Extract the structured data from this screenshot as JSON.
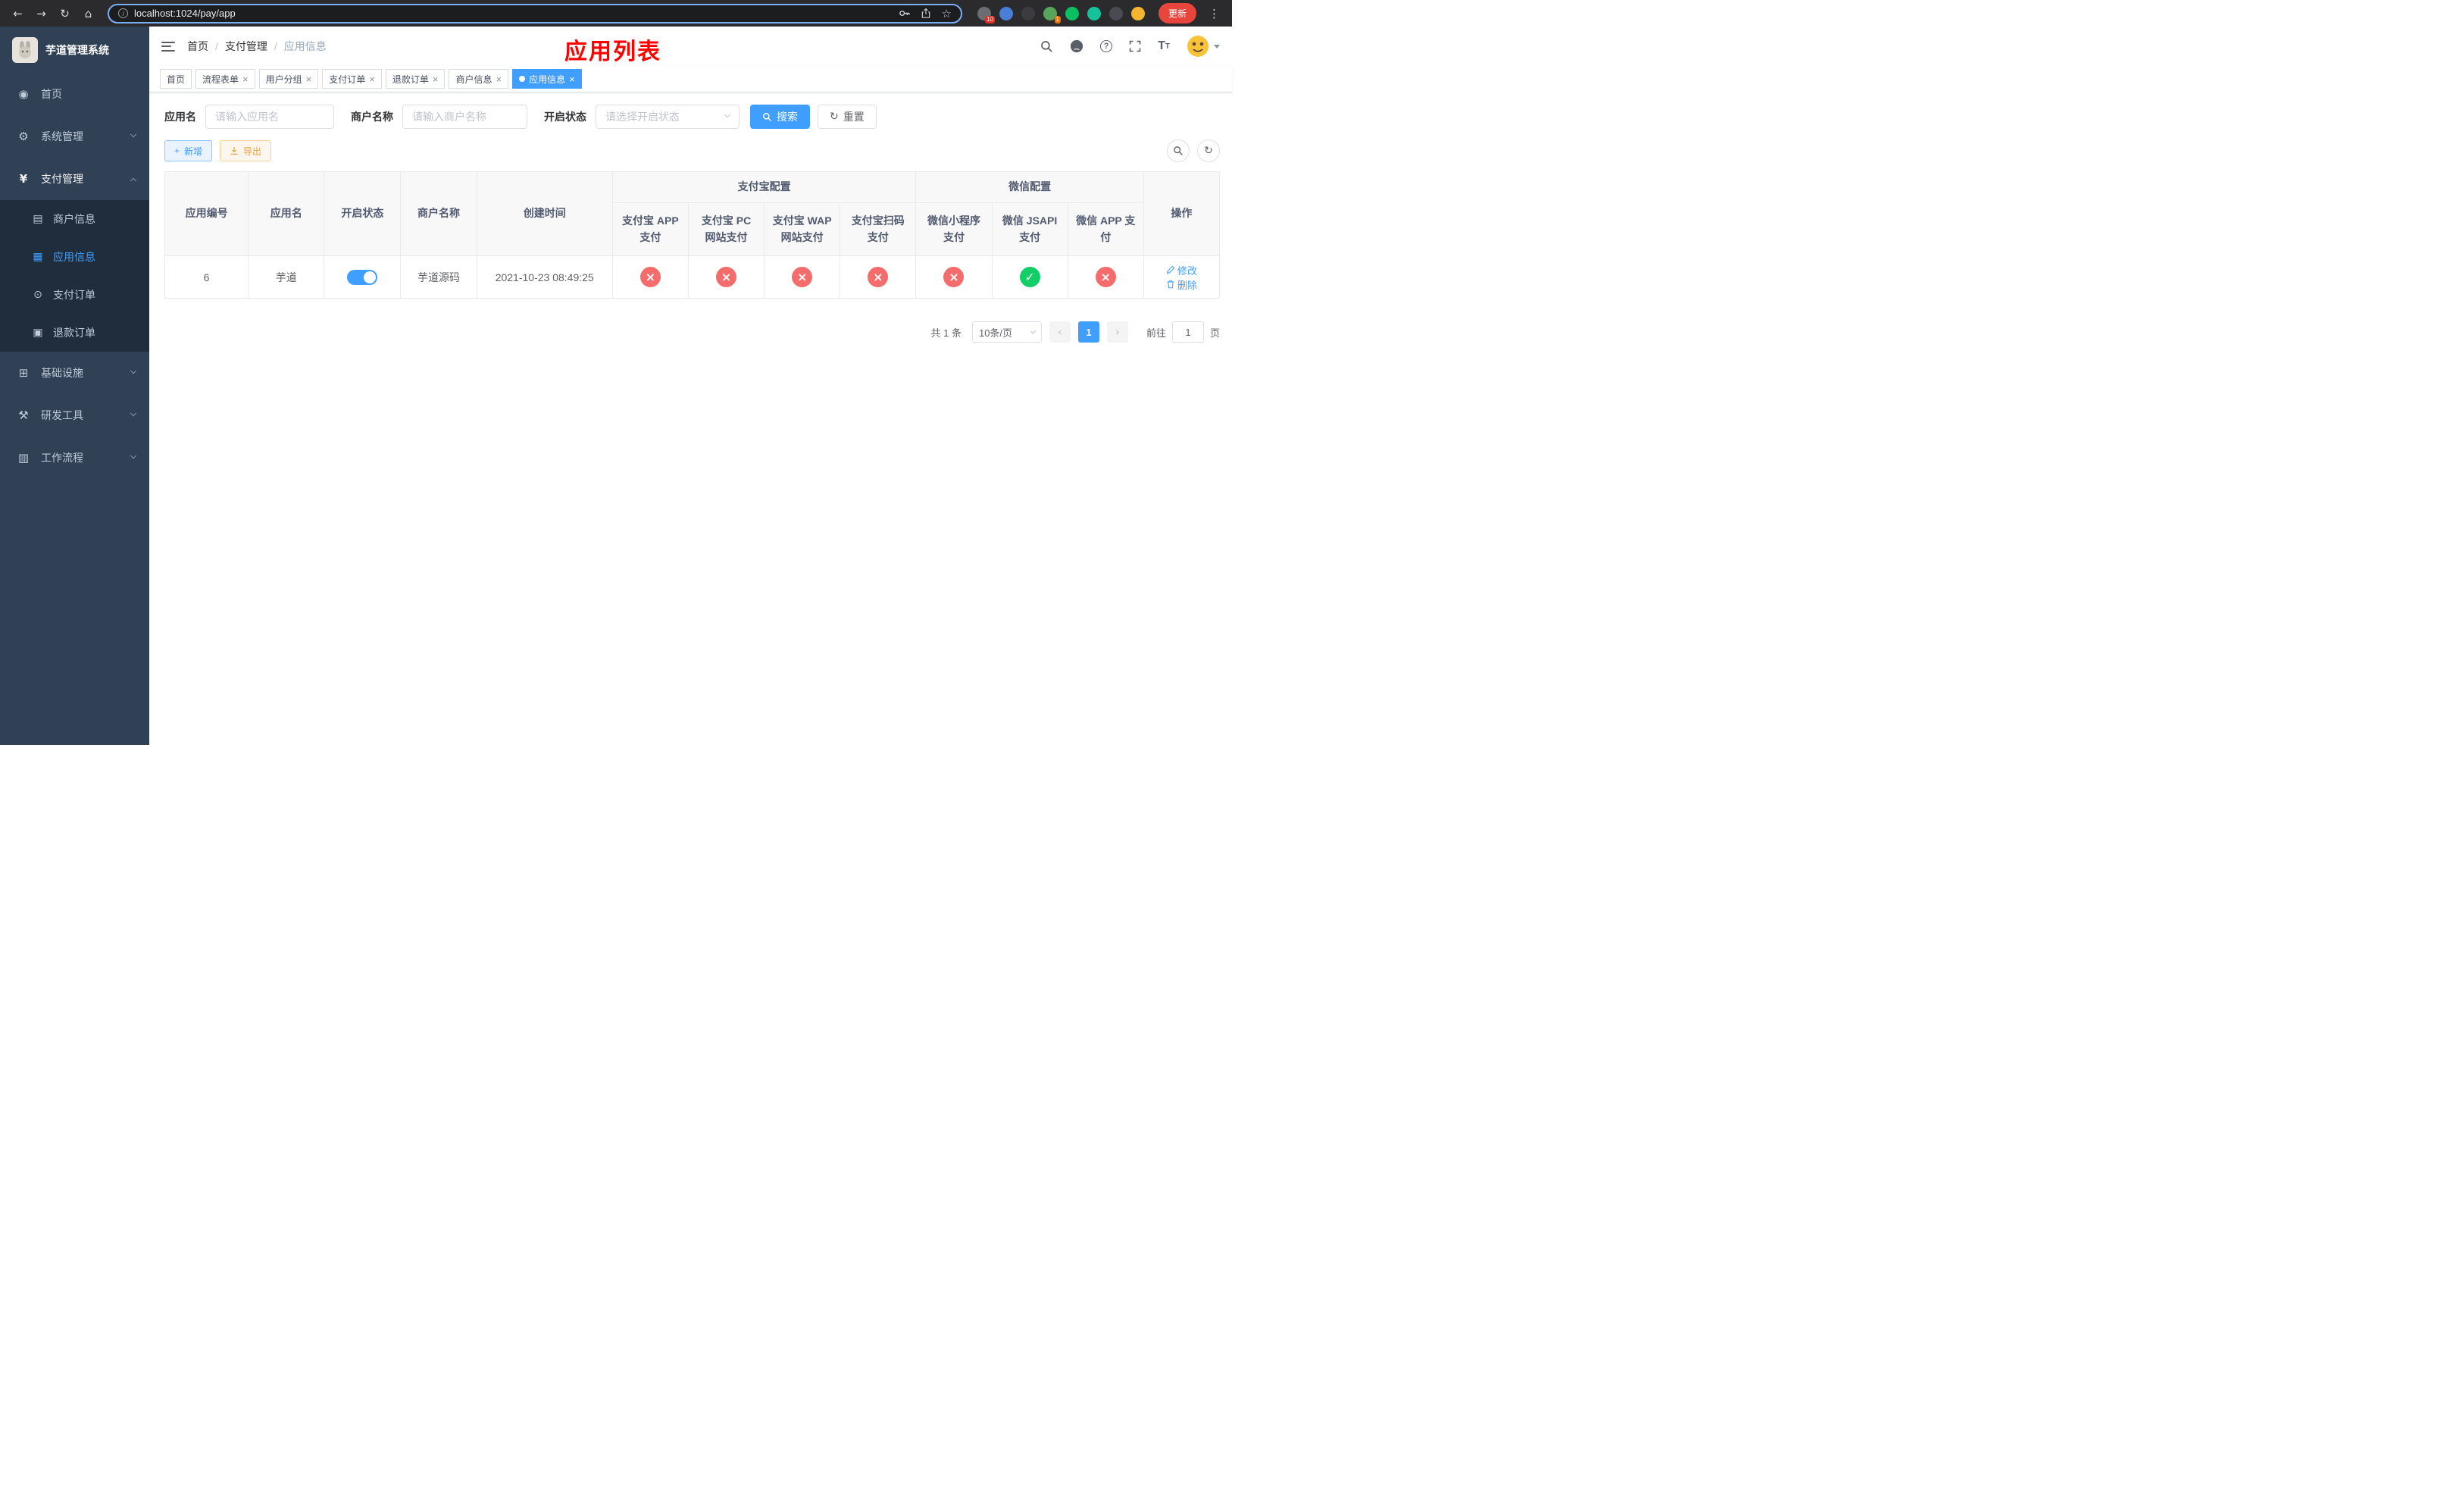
{
  "colors": {
    "accent": "#409eff",
    "danger": "#f56c6c",
    "success": "#13ce66",
    "warning": "#e6a23c",
    "annotation_red": "#ff0000",
    "sidebar_bg": "#304156",
    "submenu_bg": "#1f2d3d"
  },
  "browser": {
    "url": "localhost:1024/pay/app",
    "update_label": "更新",
    "extensions": [
      {
        "name": "extensions-puzzle",
        "color": "#6a6d72",
        "badge": "10",
        "badge_color": "#d93025"
      },
      {
        "name": "ext-blue-gem",
        "color": "#4a7dd6",
        "badge": ""
      },
      {
        "name": "ext-dark-circle",
        "color": "#3c3c40",
        "badge": ""
      },
      {
        "name": "ext-green-avatar",
        "color": "#57a55a",
        "badge": "1",
        "badge_color": "#e8710a"
      },
      {
        "name": "ext-teal-check",
        "color": "#07c160",
        "badge": ""
      },
      {
        "name": "ext-green-square",
        "color": "#15c39a",
        "badge": ""
      },
      {
        "name": "ext-pinwheel",
        "color": "#4a4a52",
        "badge": ""
      },
      {
        "name": "ext-emoji-face",
        "color": "#f5b52e",
        "badge": ""
      }
    ]
  },
  "sidebar": {
    "logo_title": "芋道管理系统",
    "items": [
      {
        "label": "首页"
      },
      {
        "label": "系统管理"
      },
      {
        "label": "支付管理"
      },
      {
        "label": "商户信息"
      },
      {
        "label": "应用信息"
      },
      {
        "label": "支付订单"
      },
      {
        "label": "退款订单"
      },
      {
        "label": "基础设施"
      },
      {
        "label": "研发工具"
      },
      {
        "label": "工作流程"
      }
    ]
  },
  "header": {
    "breadcrumb": [
      "首页",
      "支付管理",
      "应用信息"
    ],
    "annotation_title": "应用列表"
  },
  "tabs": [
    {
      "label": "首页"
    },
    {
      "label": "流程表单"
    },
    {
      "label": "用户分组"
    },
    {
      "label": "支付订单"
    },
    {
      "label": "退款订单"
    },
    {
      "label": "商户信息"
    },
    {
      "label": "应用信息"
    }
  ],
  "filters": {
    "app_name_label": "应用名",
    "app_name_placeholder": "请输入应用名",
    "merchant_label": "商户名称",
    "merchant_placeholder": "请输入商户名称",
    "status_label": "开启状态",
    "status_placeholder": "请选择开启状态",
    "search_button": "搜索",
    "reset_button": "重置"
  },
  "toolbar": {
    "add_button": "新增",
    "export_button": "导出"
  },
  "table": {
    "col_id": "应用编号",
    "col_name": "应用名",
    "col_status": "开启状态",
    "col_merchant": "商户名称",
    "col_created": "创建时间",
    "group_alipay": "支付宝配置",
    "group_wechat": "微信配置",
    "alipay_cols": [
      "支付宝 APP 支付",
      "支付宝 PC 网站支付",
      "支付宝 WAP 网站支付",
      "支付宝扫码支付"
    ],
    "wechat_cols": [
      "微信小程序支付",
      "微信 JSAPI 支付",
      "微信 APP 支付"
    ],
    "col_ops": "操作",
    "rows": [
      {
        "id": "6",
        "name": "芋道",
        "status_on": true,
        "merchant": "芋道源码",
        "created": "2021-10-23 08:49:25",
        "configs": [
          "no",
          "no",
          "no",
          "no",
          "no",
          "yes",
          "no"
        ],
        "edit_label": "修改",
        "delete_label": "删除"
      }
    ]
  },
  "pagination": {
    "total": "共 1 条",
    "page_size": "10条/页",
    "page": "1",
    "goto_label": "前往",
    "goto_value": "1",
    "goto_unit": "页"
  }
}
